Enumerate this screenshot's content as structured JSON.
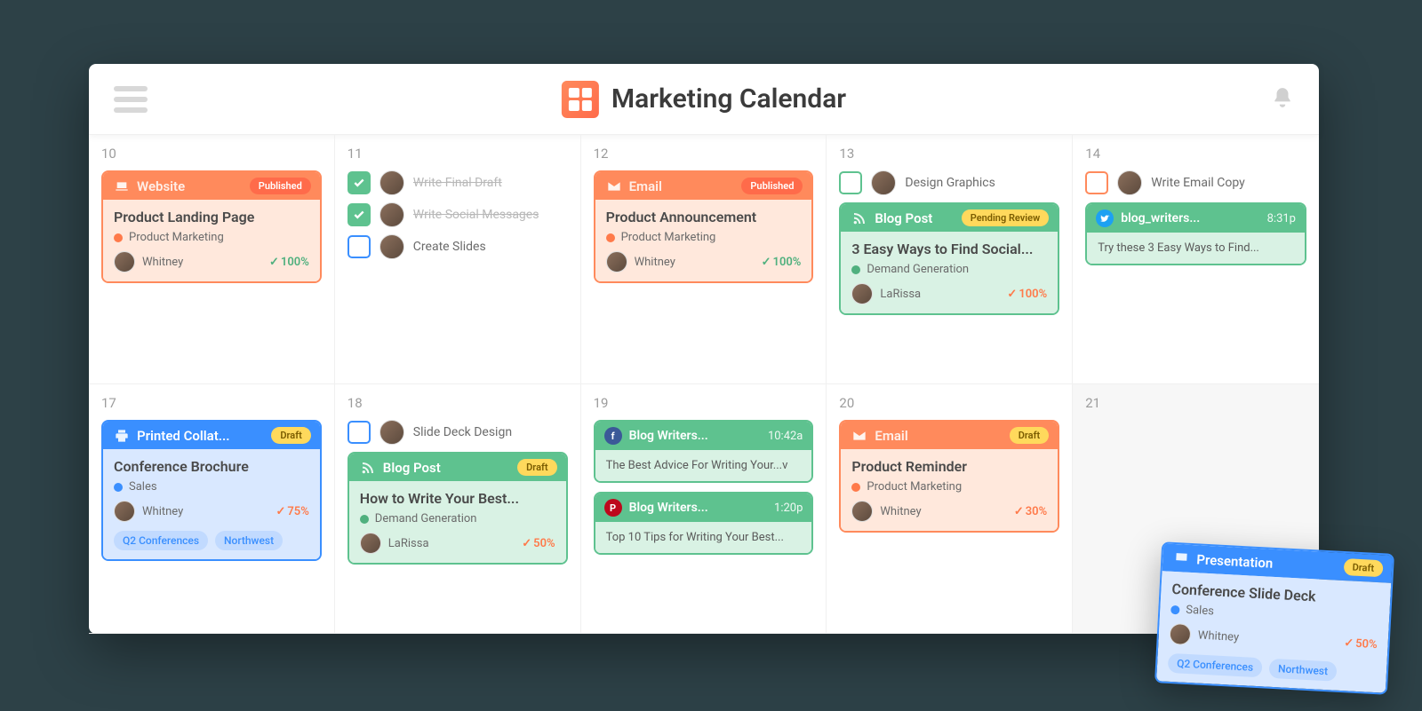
{
  "header": {
    "title": "Marketing Calendar"
  },
  "days": [
    "10",
    "11",
    "12",
    "13",
    "14",
    "17",
    "18",
    "19",
    "20",
    "21"
  ],
  "statuses": {
    "published": "Published",
    "draft": "Draft",
    "pending_review": "Pending Review"
  },
  "categories": {
    "product_marketing": {
      "label": "Product Marketing",
      "color": "#ff7a4a"
    },
    "demand_gen": {
      "label": "Demand Generation",
      "color": "#4fb07e"
    },
    "sales": {
      "label": "Sales",
      "color": "#3a8fff"
    }
  },
  "owners": {
    "whitney": "Whitney",
    "larissa": "LaRissa"
  },
  "tasks_d11": [
    {
      "label": "Write Final Draft",
      "done": true
    },
    {
      "label": "Write Social Messages",
      "done": true
    },
    {
      "label": "Create Slides",
      "done": false
    }
  ],
  "task_d13": {
    "label": "Design Graphics"
  },
  "task_d14": {
    "label": "Write Email Copy"
  },
  "task_d18": {
    "label": "Slide Deck Design"
  },
  "cards": {
    "d10_website": {
      "type": "Website",
      "status": "Published",
      "title": "Product Landing Page",
      "cat": "product_marketing",
      "owner": "whitney",
      "progress": "100%"
    },
    "d12_email": {
      "type": "Email",
      "status": "Published",
      "title": "Product Announcement",
      "cat": "product_marketing",
      "owner": "whitney",
      "progress": "100%"
    },
    "d13_blog": {
      "type": "Blog Post",
      "status": "Pending Review",
      "title": "3 Easy Ways to Find Social...",
      "cat": "demand_gen",
      "owner": "larissa",
      "progress": "100%"
    },
    "d17_print": {
      "type": "Printed Collat...",
      "status": "Draft",
      "title": "Conference Brochure",
      "cat": "sales",
      "owner": "whitney",
      "progress": "75%",
      "tags": [
        "Q2 Conferences",
        "Northwest"
      ]
    },
    "d18_blog": {
      "type": "Blog Post",
      "status": "Draft",
      "title": "How to Write Your Best...",
      "cat": "demand_gen",
      "owner": "larissa",
      "progress": "50%"
    },
    "d20_email": {
      "type": "Email",
      "status": "Draft",
      "title": "Product Reminder",
      "cat": "product_marketing",
      "owner": "whitney",
      "progress": "30%"
    },
    "d21_pres": {
      "type": "Presentation",
      "status": "Draft",
      "title": "Conference Slide Deck",
      "cat": "sales",
      "owner": "whitney",
      "progress": "50%",
      "tags": [
        "Q2 Conferences",
        "Northwest"
      ]
    }
  },
  "social": {
    "d14_tw": {
      "name": "blog_writers...",
      "time": "8:31p",
      "body": "Try these 3 Easy Ways to Find..."
    },
    "d19_fb": {
      "name": "Blog Writers...",
      "time": "10:42a",
      "body": "The Best Advice For Writing Your...v"
    },
    "d19_pi": {
      "name": "Blog Writers...",
      "time": "1:20p",
      "body": "Top 10 Tips for Writing Your Best..."
    }
  }
}
